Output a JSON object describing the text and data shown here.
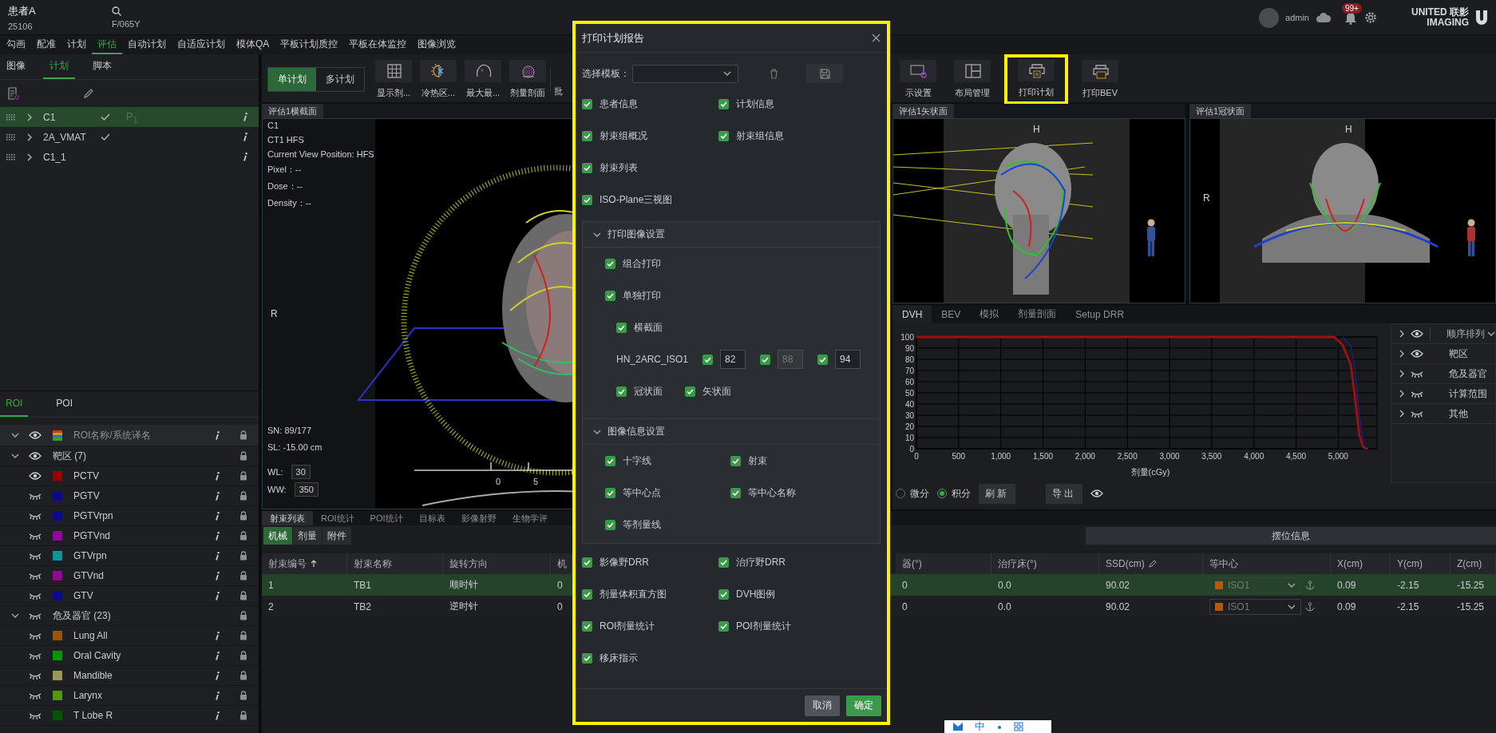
{
  "header": {
    "patient_name": "患者A",
    "patient_id": "25106",
    "patient_info": "F/065Y",
    "user": "admin",
    "notification_count": "99+",
    "logo_lines": [
      "UNITED 联影",
      "IMAGING"
    ]
  },
  "nav_tabs": [
    {
      "label": "勾画",
      "selected": false
    },
    {
      "label": "配准",
      "selected": false
    },
    {
      "label": "计划",
      "selected": false
    },
    {
      "label": "评估",
      "selected": true
    },
    {
      "label": "自动计划",
      "selected": false
    },
    {
      "label": "自适应计划",
      "selected": false
    },
    {
      "label": "模体QA",
      "selected": false
    },
    {
      "label": "平板计划质控",
      "selected": false
    },
    {
      "label": "平板在体监控",
      "selected": false
    },
    {
      "label": "图像浏览",
      "selected": false
    }
  ],
  "left_panel": {
    "tabs": [
      {
        "label": "图像",
        "selected": false
      },
      {
        "label": "计划",
        "selected": true
      },
      {
        "label": "脚本",
        "selected": false
      }
    ],
    "plans": [
      {
        "name": "C1",
        "selected": true,
        "approved": true,
        "marker": "P$_{1}$"
      },
      {
        "name": "2A_VMAT",
        "selected": false,
        "approved": true
      },
      {
        "name": "C1_1",
        "selected": false,
        "approved": false
      }
    ]
  },
  "roi_panel": {
    "tabs": [
      {
        "label": "ROI",
        "selected": true
      },
      {
        "label": "POI",
        "selected": false
      }
    ],
    "header": {
      "label": "ROI名称/系统译名",
      "visible": true
    },
    "groups": [
      {
        "label": "靶区 (7)",
        "expanded": true,
        "visible": true,
        "children": [
          {
            "name": "PCTV",
            "color": "#990000",
            "visible": true
          },
          {
            "name": "PGTV",
            "color": "#0a0a8c",
            "visible": false
          },
          {
            "name": "PGTVrpn",
            "color": "#0a0a8c",
            "visible": false
          },
          {
            "name": "PGTVnd",
            "color": "#990099",
            "visible": false
          },
          {
            "name": "GTVrpn",
            "color": "#009999",
            "visible": false
          },
          {
            "name": "GTVnd",
            "color": "#990099",
            "visible": false
          },
          {
            "name": "GTV",
            "color": "#0a0a8c",
            "visible": false
          }
        ]
      },
      {
        "label": "危及器官 (23)",
        "expanded": true,
        "visible": false,
        "children": [
          {
            "name": "Lung All",
            "color": "#995500",
            "visible": false
          },
          {
            "name": "Oral Cavity",
            "color": "#009900",
            "visible": false
          },
          {
            "name": "Mandible",
            "color": "#999955",
            "visible": false
          },
          {
            "name": "Larynx",
            "color": "#559900",
            "visible": false
          },
          {
            "name": "T Lobe R",
            "color": "#005500",
            "visible": false
          }
        ]
      }
    ]
  },
  "toolbar": {
    "plan_modes": [
      {
        "label": "单计划",
        "selected": true
      },
      {
        "label": "多计划",
        "selected": false
      }
    ],
    "tools_left": [
      {
        "label": "显示剂...",
        "kind": "grid",
        "highlighted": false
      },
      {
        "label": "冷热区...",
        "kind": "cold-hot",
        "highlighted": false
      },
      {
        "label": "最大最...",
        "kind": "head",
        "highlighted": false
      },
      {
        "label": "剂量剖面",
        "kind": "profile",
        "highlighted": false
      },
      {
        "label": "批",
        "kind": "none",
        "highlighted": false
      }
    ],
    "tools_right": [
      {
        "label": "示设置",
        "kind": "display-settings",
        "highlighted": false
      },
      {
        "label": "布局管理",
        "kind": "layout",
        "highlighted": false
      },
      {
        "label": "打印计划",
        "kind": "printer",
        "highlighted": true
      },
      {
        "label": "打印BEV",
        "kind": "printer-bev",
        "highlighted": false
      }
    ]
  },
  "viewers": [
    {
      "title": "评估1横截面",
      "kind": "axial",
      "info_lines": [
        "C1",
        "CT1 HFS",
        "Current View Position: HFS",
        "Pixel：--",
        "Dose：--",
        "Density：--"
      ],
      "slice_lines": [
        "SN: 89/177",
        "SL: -15.00 cm"
      ],
      "window_settings": [
        {
          "label": "WL:",
          "value": "30"
        },
        {
          "label": "WW:",
          "value": "350"
        }
      ],
      "orientation_labels": [
        "R"
      ],
      "ruler_labels": [
        "0",
        "5"
      ]
    },
    {
      "title": "评估1矢状面",
      "kind": "sagittal",
      "orientation_labels": [
        "H"
      ]
    },
    {
      "title": "评估1冠状面",
      "kind": "coronal",
      "orientation_labels": [
        "H",
        "R"
      ]
    }
  ],
  "dvh_panel": {
    "tabs": [
      {
        "label": "DVH",
        "selected": true
      },
      {
        "label": "BEV",
        "selected": false
      },
      {
        "label": "模拟",
        "selected": false
      },
      {
        "label": "剂量剖面",
        "selected": false
      },
      {
        "label": "Setup DRR",
        "selected": false
      }
    ],
    "chart_data": {
      "type": "line",
      "xlabel": "剂量(cGy)",
      "x": [
        0,
        4950,
        5050,
        5150,
        5200,
        5250,
        5300,
        5350
      ],
      "series": [
        {
          "color": "#a01010",
          "values": [
            100,
            100,
            93,
            75,
            45,
            12,
            1,
            0
          ]
        },
        {
          "color": "#202090",
          "values": [
            null,
            null,
            100,
            92,
            70,
            30,
            3,
            0
          ]
        }
      ],
      "grid": true,
      "xlim": [
        0,
        5460
      ],
      "ylim": [
        0,
        100
      ],
      "xticks": [
        0,
        500,
        {
          "value": 1000,
          "label": "1,000"
        },
        {
          "value": 1500,
          "label": "1,500"
        },
        {
          "value": 2000,
          "label": "2,000"
        },
        {
          "value": 2500,
          "label": "2,500"
        },
        {
          "value": 3000,
          "label": "3,000"
        },
        {
          "value": 3500,
          "label": "3,500"
        },
        {
          "value": 4000,
          "label": "4,000"
        },
        {
          "value": 4500,
          "label": "4,500"
        },
        {
          "value": 5000,
          "label": "5,000"
        }
      ],
      "yticks": [
        0,
        10,
        20,
        30,
        40,
        50,
        60,
        70,
        80,
        90,
        100
      ]
    },
    "modes": [
      {
        "label": "微分",
        "selected": false
      },
      {
        "label": "积分",
        "selected": true
      }
    ],
    "buttons": [
      "刷新",
      "导出"
    ],
    "roi_filter": {
      "header": {
        "label": "顺序排列",
        "visible": true
      },
      "items": [
        {
          "label": "靶区",
          "visible": true
        },
        {
          "label": "危及器官",
          "visible": false
        },
        {
          "label": "计算范围",
          "visible": false
        },
        {
          "label": "其他",
          "visible": false
        }
      ]
    }
  },
  "bottom_panel": {
    "tabs": [
      {
        "label": "射束列表",
        "selected": true
      },
      {
        "label": "ROI统计",
        "selected": false
      },
      {
        "label": "POI统计",
        "selected": false
      },
      {
        "label": "目标表",
        "selected": false
      },
      {
        "label": "影像射野",
        "selected": false
      },
      {
        "label": "生物学评",
        "selected": false
      }
    ],
    "sub_tabs": [
      {
        "label": "机械",
        "selected": true
      },
      {
        "label": "剂量",
        "selected": false
      },
      {
        "label": "附件",
        "selected": false
      }
    ],
    "setup_button": "摆位信息",
    "table": {
      "columns": [
        {
          "label": "射束编号",
          "sort_ascending": true
        },
        {
          "label": "射束名称"
        },
        {
          "label": "旋转方向"
        },
        {
          "label": "机"
        },
        {
          "label": "器(°)"
        },
        {
          "label": "治疗床(°)"
        },
        {
          "label": "SSD(cm)",
          "editable": true
        },
        {
          "label": "等中心",
          "kind": "isocenter"
        },
        {
          "label": "X(cm)"
        },
        {
          "label": "Y(cm)"
        },
        {
          "label": "Z(cm)"
        }
      ],
      "rows": [
        {
          "selected": true,
          "cells": [
            "1",
            "TB1",
            "顺时针",
            "0",
            "0",
            "0.0",
            "90.02",
            "ISO1",
            "0.09",
            "-2.15",
            "-15.25"
          ]
        },
        {
          "selected": false,
          "cells": [
            "2",
            "TB2",
            "逆时针",
            "0",
            "0",
            "0.0",
            "90.02",
            "ISO1",
            "0.09",
            "-2.15",
            "-15.25"
          ]
        }
      ]
    }
  },
  "print_dialog": {
    "title": "打印计划报告",
    "template_label": "选择模板：",
    "rows_top": [
      [
        {
          "label": "患者信息",
          "checked": true
        },
        {
          "label": "计划信息",
          "checked": true
        }
      ],
      [
        {
          "label": "射束组概况",
          "checked": true
        },
        {
          "label": "射束组信息",
          "checked": true
        }
      ],
      [
        {
          "label": "射束列表",
          "checked": true
        }
      ],
      [
        {
          "label": "ISO-Plane三视图",
          "checked": true
        }
      ]
    ],
    "image_section": {
      "title": "打印图像设置",
      "expanded": true,
      "items": [
        {
          "label": "组合打印",
          "checked": true
        },
        {
          "label": "单独打印",
          "checked": true,
          "children": [
            {
              "label": "横截面",
              "checked": true
            }
          ]
        }
      ],
      "series": {
        "name": "HN_2ARC_ISO1",
        "slices": [
          {
            "value": "82",
            "checked": true,
            "disabled": false
          },
          {
            "value": "88",
            "checked": true,
            "disabled": true
          },
          {
            "value": "94",
            "checked": true,
            "disabled": false
          }
        ]
      },
      "views": [
        {
          "label": "冠状面",
          "checked": true
        },
        {
          "label": "矢状面",
          "checked": true
        }
      ]
    },
    "info_section": {
      "title": "图像信息设置",
      "expanded": true,
      "rows": [
        [
          {
            "label": "十字线",
            "checked": true
          },
          {
            "label": "射束",
            "checked": true
          }
        ],
        [
          {
            "label": "等中心点",
            "checked": true
          },
          {
            "label": "等中心名称",
            "checked": true
          }
        ],
        [
          {
            "label": "等剂量线",
            "checked": true
          }
        ]
      ]
    },
    "rows_bottom": [
      [
        {
          "label": "影像野DRR",
          "checked": true
        },
        {
          "label": "治疗野DRR",
          "checked": true
        }
      ],
      [
        {
          "label": "剂量体积直方图",
          "checked": true
        },
        {
          "label": "DVH图例",
          "checked": true
        }
      ],
      [
        {
          "label": "ROI剂量统计",
          "checked": true
        },
        {
          "label": "POI剂量统计",
          "checked": true
        }
      ],
      [
        {
          "label": "移床指示",
          "checked": true
        }
      ]
    ],
    "buttons": [
      {
        "label": "取消",
        "kind": "secondary"
      },
      {
        "label": "确定",
        "kind": "primary"
      }
    ]
  },
  "ime_toolbar": {
    "label": "中"
  }
}
